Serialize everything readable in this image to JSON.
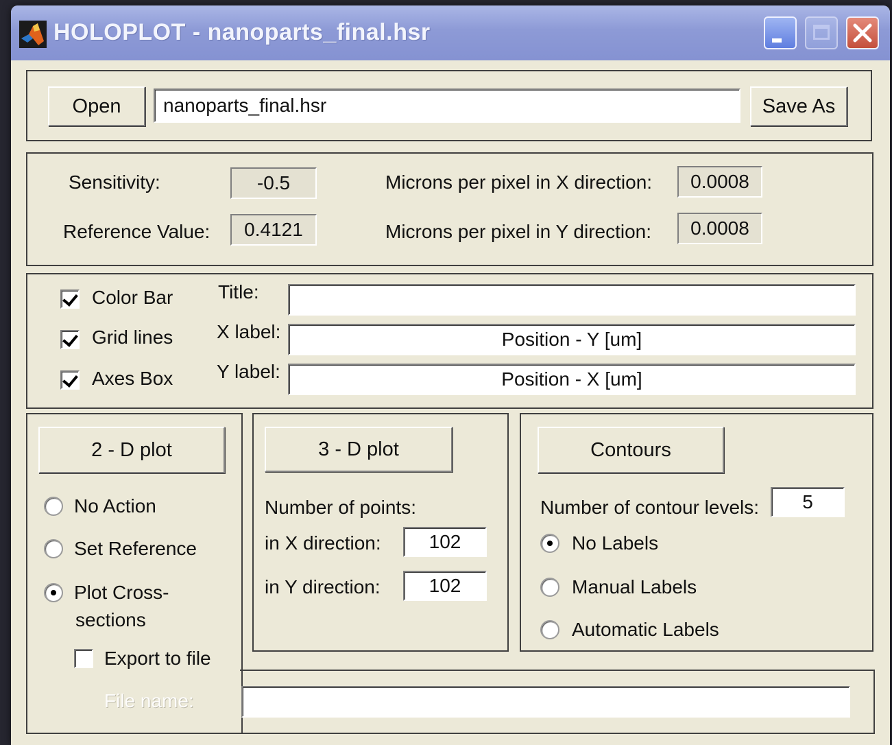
{
  "window": {
    "title": "HOLOPLOT - nanoparts_final.hsr",
    "app_icon": "matlab-logo",
    "controls": [
      "minimize-icon",
      "maximize-icon",
      "close-icon"
    ]
  },
  "file": {
    "open_label": "Open",
    "filename": "nanoparts_final.hsr",
    "save_as_label": "Save As"
  },
  "params": {
    "sensitivity_label": "Sensitivity:",
    "sensitivity_value": "-0.5",
    "reference_label": "Reference Value:",
    "reference_value": "0.4121",
    "mpp_x_label": "Microns per pixel in X direction:",
    "mpp_x_value": "0.0008",
    "mpp_y_label": "Microns per pixel in Y direction:",
    "mpp_y_value": "0.0008"
  },
  "options": {
    "color_bar": {
      "label": "Color Bar",
      "checked": true
    },
    "grid_lines": {
      "label": "Grid lines",
      "checked": true
    },
    "axes_box": {
      "label": "Axes Box",
      "checked": true
    },
    "title_label": "Title:",
    "title_value": "",
    "xlabel_label": "X label:",
    "xlabel_value": "Position - Y [um]",
    "ylabel_label": "Y label:",
    "ylabel_value": "Position - X [um]"
  },
  "plot2d": {
    "button_label": "2 - D plot",
    "radios": [
      {
        "label": "No Action",
        "selected": false
      },
      {
        "label": "Set Reference",
        "selected": false
      },
      {
        "label": "Plot Cross-",
        "label2": "sections",
        "selected": true
      }
    ],
    "export_label": "Export to file",
    "export_checked": false,
    "file_name_label": "File name:",
    "file_name_value": ""
  },
  "plot3d": {
    "button_label": "3 - D plot",
    "points_label": "Number of points:",
    "x_dir_label": "in X direction:",
    "x_dir_value": "102",
    "y_dir_label": "in Y direction:",
    "y_dir_value": "102"
  },
  "contours": {
    "button_label": "Contours",
    "levels_label": "Number of contour levels:",
    "levels_value": "5",
    "radios": [
      {
        "label": "No Labels",
        "selected": true
      },
      {
        "label": "Manual Labels",
        "selected": false
      },
      {
        "label": "Automatic Labels",
        "selected": false
      }
    ]
  }
}
